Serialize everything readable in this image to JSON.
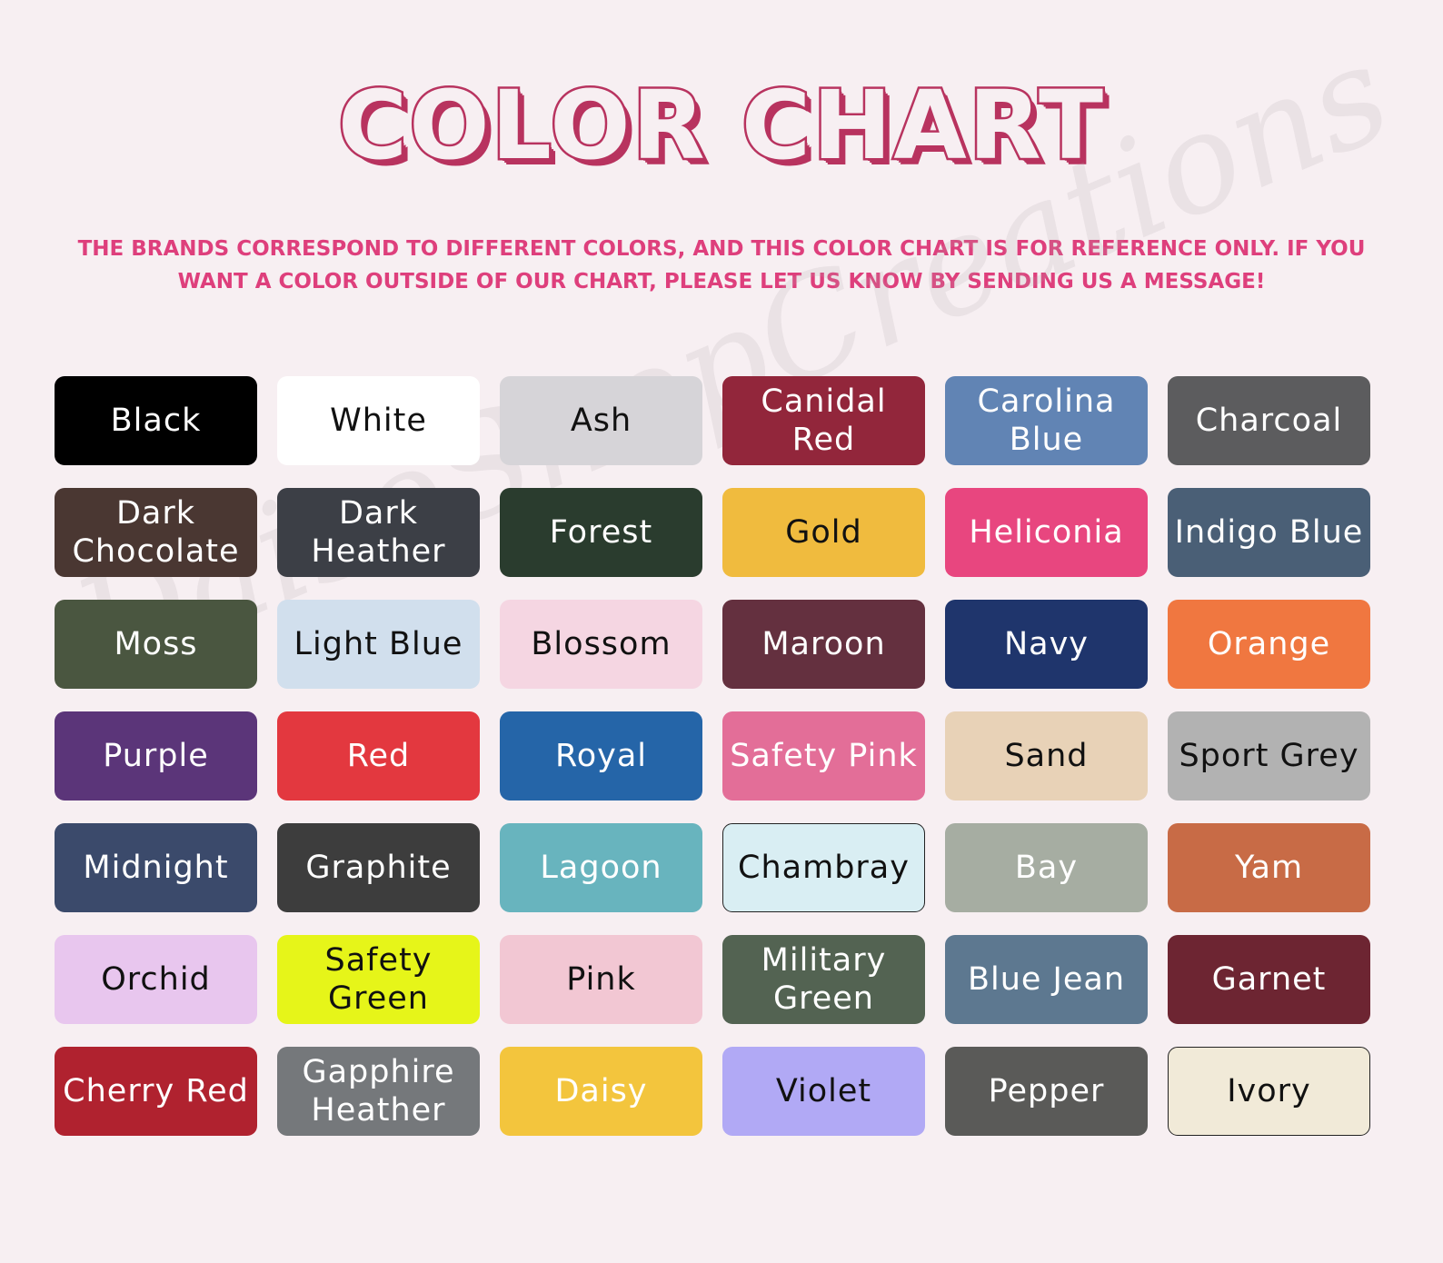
{
  "title": "COLOR CHART",
  "subtitle": "THE BRANDS CORRESPOND TO DIFFERENT COLORS, AND THIS COLOR CHART IS FOR REFERENCE ONLY. IF YOU WANT A COLOR OUTSIDE OF OUR CHART, PLEASE LET US KNOW BY SENDING US A MESSAGE!",
  "watermark": "DaisoShopCreations",
  "colors": [
    {
      "label": "Black",
      "bg": "#000000",
      "fg": "#ffffff"
    },
    {
      "label": "White",
      "bg": "#ffffff",
      "fg": "#111111"
    },
    {
      "label": "Ash",
      "bg": "#d6d4d8",
      "fg": "#111111"
    },
    {
      "label": "Canidal Red",
      "bg": "#92263b",
      "fg": "#ffffff"
    },
    {
      "label": "Carolina Blue",
      "bg": "#6184b4",
      "fg": "#ffffff"
    },
    {
      "label": "Charcoal",
      "bg": "#5c5c5e",
      "fg": "#ffffff"
    },
    {
      "label": "Dark Chocolate",
      "bg": "#4a3732",
      "fg": "#ffffff"
    },
    {
      "label": "Dark Heather",
      "bg": "#3c3f46",
      "fg": "#ffffff"
    },
    {
      "label": "Forest",
      "bg": "#2a3c2e",
      "fg": "#ffffff"
    },
    {
      "label": "Gold",
      "bg": "#f0bb3e",
      "fg": "#111111"
    },
    {
      "label": "Heliconia",
      "bg": "#e8467f",
      "fg": "#ffffff"
    },
    {
      "label": "Indigo Blue",
      "bg": "#4a5f76",
      "fg": "#ffffff"
    },
    {
      "label": "Moss",
      "bg": "#4a5640",
      "fg": "#ffffff"
    },
    {
      "label": "Light Blue",
      "bg": "#d1dfed",
      "fg": "#111111"
    },
    {
      "label": "Blossom",
      "bg": "#f5d6e2",
      "fg": "#111111"
    },
    {
      "label": "Maroon",
      "bg": "#64303f",
      "fg": "#ffffff"
    },
    {
      "label": "Navy",
      "bg": "#1f356c",
      "fg": "#ffffff"
    },
    {
      "label": "Orange",
      "bg": "#f07740",
      "fg": "#ffffff"
    },
    {
      "label": "Purple",
      "bg": "#5b3579",
      "fg": "#ffffff"
    },
    {
      "label": "Red",
      "bg": "#e3383f",
      "fg": "#ffffff"
    },
    {
      "label": "Royal",
      "bg": "#2565a8",
      "fg": "#ffffff"
    },
    {
      "label": "Safety Pink",
      "bg": "#e36e98",
      "fg": "#ffffff"
    },
    {
      "label": "Sand",
      "bg": "#e8d2b7",
      "fg": "#111111"
    },
    {
      "label": "Sport Grey",
      "bg": "#b2b2b2",
      "fg": "#111111"
    },
    {
      "label": "Midnight",
      "bg": "#3b4a6b",
      "fg": "#ffffff"
    },
    {
      "label": "Graphite",
      "bg": "#3d3d3d",
      "fg": "#ffffff"
    },
    {
      "label": "Lagoon",
      "bg": "#68b4be",
      "fg": "#ffffff"
    },
    {
      "label": "Chambray",
      "bg": "#d9eef3",
      "fg": "#111111",
      "outlined": true
    },
    {
      "label": "Bay",
      "bg": "#a6ada2",
      "fg": "#ffffff"
    },
    {
      "label": "Yam",
      "bg": "#c86b46",
      "fg": "#ffffff"
    },
    {
      "label": "Orchid",
      "bg": "#e8c6ee",
      "fg": "#111111"
    },
    {
      "label": "Safety Green",
      "bg": "#e6f519",
      "fg": "#111111"
    },
    {
      "label": "Pink",
      "bg": "#f2c7d3",
      "fg": "#111111"
    },
    {
      "label": "Military Green",
      "bg": "#536352",
      "fg": "#ffffff"
    },
    {
      "label": "Blue Jean",
      "bg": "#5d7890",
      "fg": "#ffffff"
    },
    {
      "label": "Garnet",
      "bg": "#6d2532",
      "fg": "#ffffff"
    },
    {
      "label": "Cherry Red",
      "bg": "#b0222f",
      "fg": "#ffffff"
    },
    {
      "label": "Gapphire Heather",
      "bg": "#75787b",
      "fg": "#ffffff"
    },
    {
      "label": "Daisy",
      "bg": "#f3c53d",
      "fg": "#ffffff"
    },
    {
      "label": "Violet",
      "bg": "#b1a9f5",
      "fg": "#111111"
    },
    {
      "label": "Pepper",
      "bg": "#5a5a58",
      "fg": "#ffffff"
    },
    {
      "label": "Ivory",
      "bg": "#f1ead8",
      "fg": "#111111",
      "outlined": true
    }
  ]
}
